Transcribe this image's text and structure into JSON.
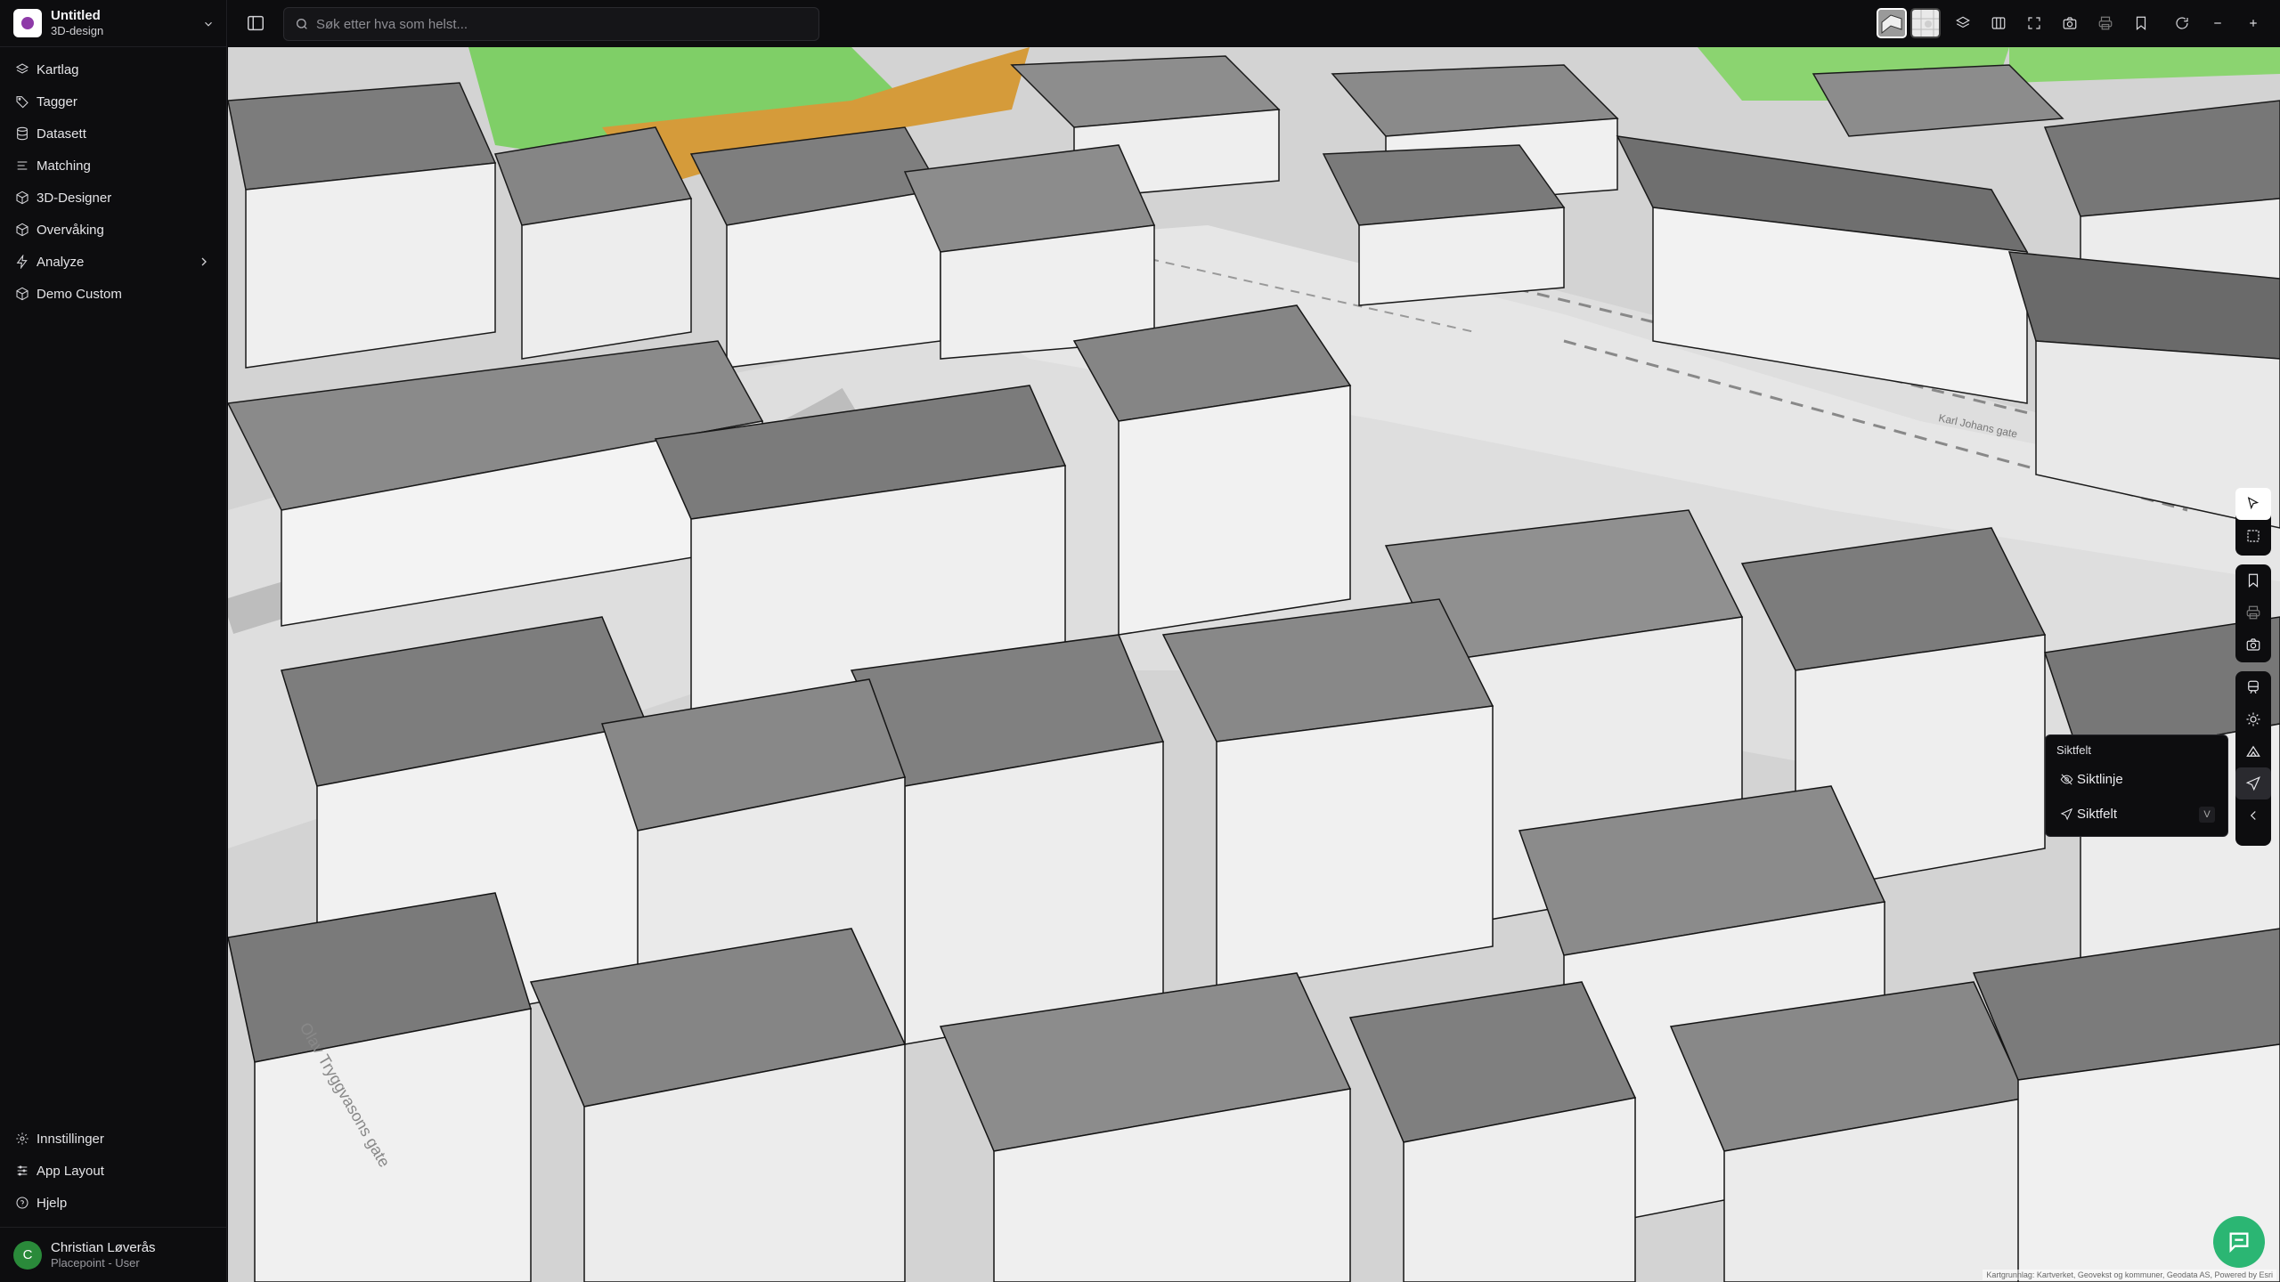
{
  "app": {
    "title": "Untitled",
    "subtitle": "3D-design"
  },
  "sidebar": {
    "items": [
      {
        "label": "Kartlag",
        "icon": "layers-icon"
      },
      {
        "label": "Tagger",
        "icon": "tag-icon"
      },
      {
        "label": "Datasett",
        "icon": "database-icon"
      },
      {
        "label": "Matching",
        "icon": "list-icon"
      },
      {
        "label": "3D-Designer",
        "icon": "cube-icon"
      },
      {
        "label": "Overvåking",
        "icon": "cube-icon"
      },
      {
        "label": "Analyze",
        "icon": "bolt-icon"
      },
      {
        "label": "Demo Custom",
        "icon": "cube-icon"
      }
    ],
    "footer_items": [
      {
        "label": "Innstillinger",
        "icon": "gear-icon"
      },
      {
        "label": "App Layout",
        "icon": "sliders-icon"
      },
      {
        "label": "Hjelp",
        "icon": "help-icon"
      }
    ]
  },
  "user": {
    "initial": "C",
    "name": "Christian Løverås",
    "role": "Placepoint - User"
  },
  "search": {
    "placeholder": "Søk etter hva som helst..."
  },
  "popup": {
    "title": "Siktfelt",
    "items": [
      {
        "label": "Siktlinje",
        "icon": "eye-off-icon"
      },
      {
        "label": "Siktfelt",
        "icon": "send-icon",
        "shortcut": "V"
      }
    ]
  },
  "map": {
    "attribution": "Kartgrunnlag: Kartverket, Geovekst og kommuner, Geodata AS, Powered by Esri",
    "street_labels": [
      "Karl Johans gate",
      "Olav Tryggvasons gate"
    ]
  }
}
